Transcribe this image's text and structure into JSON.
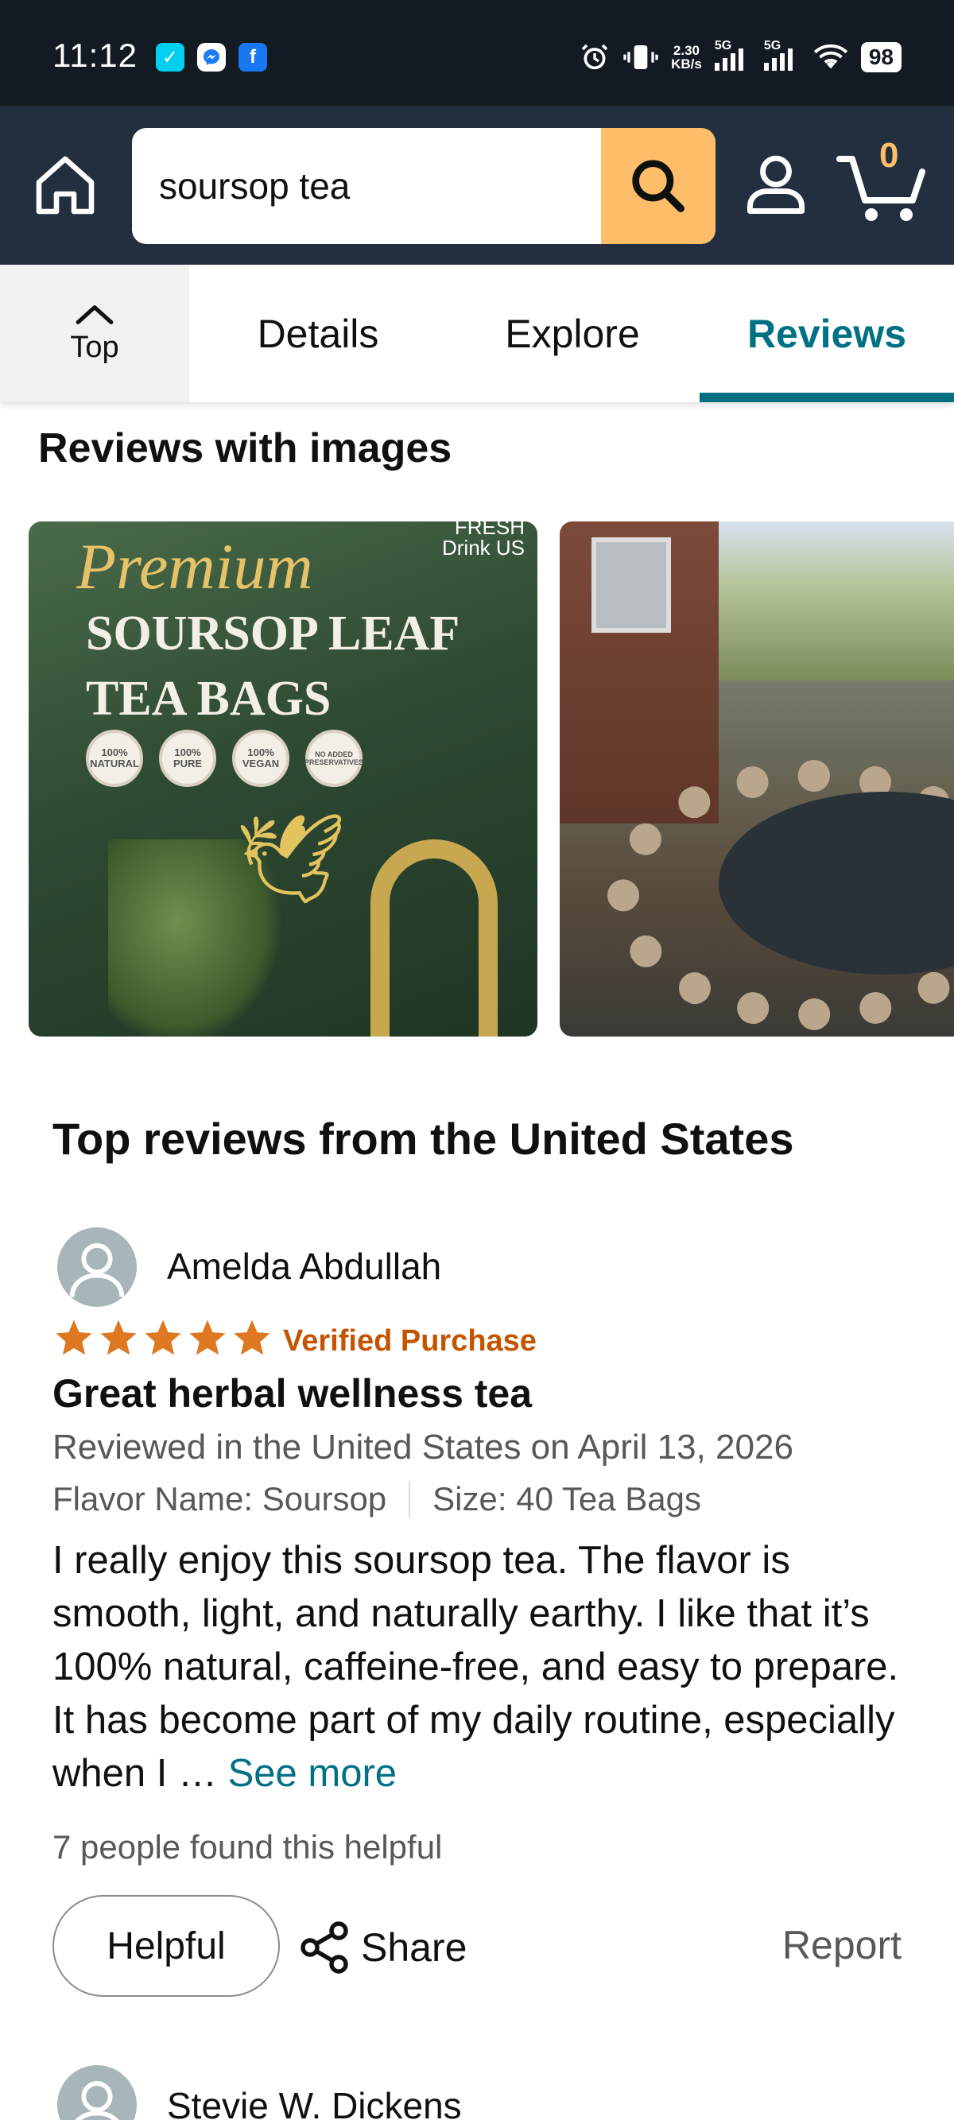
{
  "status_bar": {
    "time": "11:12",
    "net_speed_value": "2.30",
    "net_speed_unit": "KB/s",
    "sim1_label": "5G",
    "sim2_label": "5G",
    "battery": "98"
  },
  "header": {
    "search_value": "soursop tea",
    "cart_count": "0"
  },
  "tabs": {
    "top_label": "Top",
    "items": [
      {
        "label": "Details"
      },
      {
        "label": "Explore"
      },
      {
        "label": "Reviews"
      }
    ],
    "active_tab": "Reviews"
  },
  "reviews_with_images": {
    "title": "Reviews with images",
    "images": [
      {
        "kind": "product-package",
        "brand_line1": "FRESH",
        "brand_line2": "Drink US",
        "premium": "Premium",
        "title_line1": "SOURSOP LEAF",
        "title_line2": "TEA BAGS",
        "badges": [
          "100% NATURAL",
          "100% PURE",
          "100% VEGAN",
          "NO ADDED PRESERVATIVES"
        ]
      },
      {
        "kind": "backyard-pond-photo"
      }
    ]
  },
  "top_reviews": {
    "title": "Top reviews from the United States",
    "reviews": [
      {
        "reviewer": "Amelda Abdullah",
        "rating": 5,
        "verified": "Verified Purchase",
        "title": "Great herbal wellness tea",
        "date": "Reviewed in the United States on April 13, 2026",
        "flavor": "Flavor Name: Soursop",
        "size": "Size: 40 Tea Bags",
        "body": "I really enjoy this soursop tea. The flavor is smooth, light, and naturally earthy. I like that it’s 100% natural, caffeine-free, and easy to prepare. It has become part of my daily routine, especially when I … ",
        "see_more": "See more",
        "helpful_count": "7 people found this helpful",
        "helpful_button": "Helpful",
        "share_button": "Share",
        "report_link": "Report"
      },
      {
        "reviewer": "Stevie W. Dickens"
      }
    ]
  },
  "colors": {
    "header_bg": "#232f3e",
    "status_bg": "#131a22",
    "search_button": "#febd69",
    "accent_teal": "#007185",
    "star": "#de7921",
    "verified": "#c45500"
  }
}
